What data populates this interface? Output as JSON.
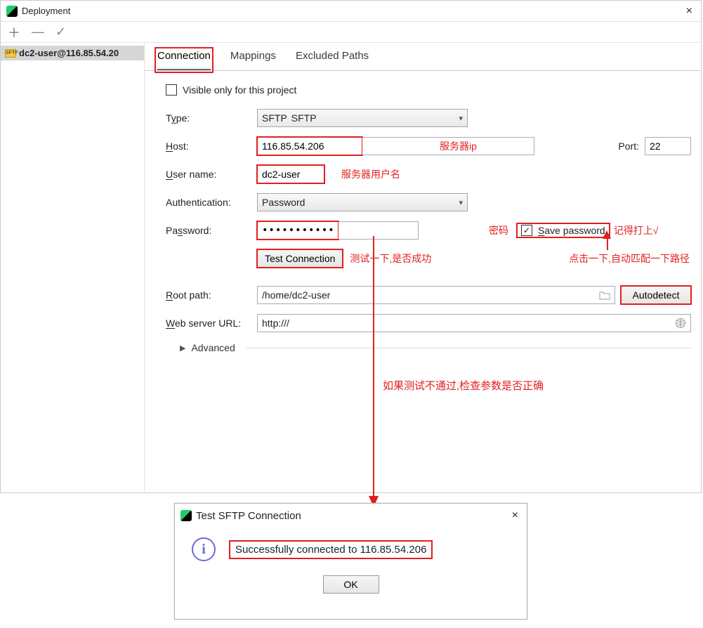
{
  "window": {
    "title": "Deployment",
    "close_glyph": "×"
  },
  "toolbar": {
    "add": "＋",
    "remove": "—",
    "check": "✓"
  },
  "sidebar": {
    "item_label": "dc2-user@116.85.54.20",
    "item_icon_text": "SFTP"
  },
  "tabs": {
    "connection": "Connection",
    "mappings": "Mappings",
    "excluded": "Excluded Paths"
  },
  "form": {
    "visible_only": "Visible only for this project",
    "type_label_pre": "T",
    "type_label_u": "y",
    "type_label_post": "pe:",
    "type_value": "SFTP",
    "host_label_u": "H",
    "host_label_post": "ost:",
    "host_value": "116.85.54.206",
    "port_label": "Port:",
    "port_value": "22",
    "user_label_u": "U",
    "user_label_post": "ser name:",
    "user_value": "dc2-user",
    "auth_label": "Authentication:",
    "auth_value": "Password",
    "pass_label_pre": "Pa",
    "pass_label_u": "s",
    "pass_label_post": "sword:",
    "pass_value": "••••••••••••••",
    "savepass_label_u": "S",
    "savepass_label_post": "ave password",
    "test_button": "Test Connection",
    "root_label_u": "R",
    "root_label_post": "oot path:",
    "root_value": "/home/dc2-user",
    "autodetect": "Autodetect",
    "web_label_u": "W",
    "web_label_post": "eb server URL:",
    "web_value": "http:///",
    "advanced": "Advanced"
  },
  "annotations": {
    "host": "服务器ip",
    "user": "服务器用户名",
    "pass": "密码",
    "savepass": "记得打上√",
    "test": "测试一下,是否成功",
    "autodetect": "点击一下,自动匹配一下路径",
    "mid": "如果测试不通过,检查参数是否正确"
  },
  "dialog": {
    "title": "Test SFTP Connection",
    "message": "Successfully connected to 116.85.54.206",
    "ok": "OK",
    "close_glyph": "×"
  }
}
